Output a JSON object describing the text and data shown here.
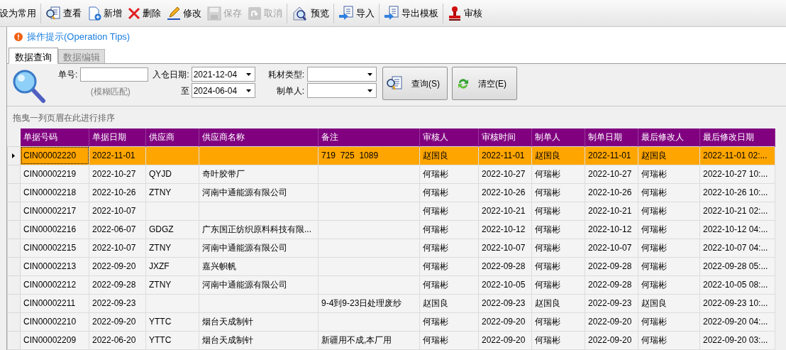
{
  "toolbar": [
    {
      "label": "设为常用",
      "kind": "text",
      "disabled": false
    },
    {
      "label": "查看",
      "kind": "view",
      "disabled": false
    },
    {
      "label": "新增",
      "kind": "add",
      "disabled": false
    },
    {
      "label": "删除",
      "kind": "delete",
      "disabled": false
    },
    {
      "label": "修改",
      "kind": "edit",
      "disabled": false
    },
    {
      "label": "保存",
      "kind": "save",
      "disabled": true
    },
    {
      "label": "取消",
      "kind": "cancel",
      "disabled": true
    },
    {
      "label": "预览",
      "kind": "preview",
      "disabled": false
    },
    {
      "label": "导入",
      "kind": "import",
      "disabled": false
    },
    {
      "label": "导出模板",
      "kind": "import",
      "disabled": false
    },
    {
      "label": "审核",
      "kind": "stamp",
      "disabled": false
    }
  ],
  "tip": "操作提示(Operation Tips)",
  "tabs": [
    {
      "label": "数据查询",
      "selected": true
    },
    {
      "label": "数据编辑",
      "selected": false
    }
  ],
  "filters": {
    "number_label": "单号:",
    "number_hint": "(模糊匹配)",
    "date_label": "入仓日期:",
    "date_from": "2021-12-04",
    "to_label": "至",
    "date_to": "2024-06-04",
    "type_label": "耗材类型:",
    "maker_label": "制单人:",
    "query_button": "查询(S)",
    "clear_button": "清空(E)"
  },
  "group_hint": "拖曳一列页眉在此进行排序",
  "table": {
    "columns": [
      "单据号码",
      "单据日期",
      "供应商",
      "供应商名称",
      "备注",
      "审核人",
      "审核时间",
      "制单人",
      "制单日期",
      "最后修改人",
      "最后修改日期"
    ],
    "rows": [
      {
        "selected": true,
        "cells": [
          "CIN00002220",
          "2022-11-01",
          "",
          "",
          "719  725  1089",
          "赵国良",
          "2022-11-01",
          "赵国良",
          "2022-11-01",
          "赵国良",
          "2022-11-01 02:..."
        ]
      },
      {
        "selected": false,
        "cells": [
          "CIN00002219",
          "2022-10-27",
          "QYJD",
          "奇叶胶带厂",
          "",
          "何瑞彬",
          "2022-10-27",
          "何瑞彬",
          "2022-10-27",
          "何瑞彬",
          "2022-10-27 10:..."
        ]
      },
      {
        "selected": false,
        "cells": [
          "CIN00002218",
          "2022-10-26",
          "ZTNY",
          "河南中通能源有限公司",
          "",
          "何瑞彬",
          "2022-10-26",
          "何瑞彬",
          "2022-10-26",
          "何瑞彬",
          "2022-10-26 10:..."
        ]
      },
      {
        "selected": false,
        "cells": [
          "CIN00002217",
          "2022-10-07",
          "",
          "",
          "",
          "何瑞彬",
          "2022-10-21",
          "何瑞彬",
          "2022-10-21",
          "何瑞彬",
          "2022-10-21 02:..."
        ]
      },
      {
        "selected": false,
        "cells": [
          "CIN00002216",
          "2022-06-07",
          "GDGZ",
          "广东国正纺织原料科技有限...",
          "",
          "何瑞彬",
          "2022-10-12",
          "何瑞彬",
          "2022-10-12",
          "何瑞彬",
          "2022-10-12 04:..."
        ]
      },
      {
        "selected": false,
        "cells": [
          "CIN00002215",
          "2022-10-07",
          "ZTNY",
          "河南中通能源有限公司",
          "",
          "何瑞彬",
          "2022-10-07",
          "何瑞彬",
          "2022-10-07",
          "何瑞彬",
          "2022-10-07 04:..."
        ]
      },
      {
        "selected": false,
        "cells": [
          "CIN00002213",
          "2022-09-20",
          "JXZF",
          "嘉兴帜帆",
          "",
          "何瑞彬",
          "2022-09-28",
          "何瑞彬",
          "2022-09-28",
          "何瑞彬",
          "2022-09-28 05:..."
        ]
      },
      {
        "selected": false,
        "cells": [
          "CIN00002212",
          "2022-09-28",
          "ZTNY",
          "河南中通能源有限公司",
          "",
          "何瑞彬",
          "2022-10-05",
          "何瑞彬",
          "2022-09-28",
          "何瑞彬",
          "2022-10-05 08:..."
        ]
      },
      {
        "selected": false,
        "cells": [
          "CIN00002211",
          "2022-09-23",
          "",
          "",
          "9-4到9-23日处理废纱",
          "赵国良",
          "2022-09-23",
          "赵国良",
          "2022-09-23",
          "赵国良",
          "2022-09-23 10:..."
        ]
      },
      {
        "selected": false,
        "cells": [
          "CIN00002210",
          "2022-09-20",
          "YTTC",
          "烟台天成制针",
          "",
          "何瑞彬",
          "2022-09-20",
          "何瑞彬",
          "2022-09-20",
          "何瑞彬",
          "2022-09-20 04:..."
        ]
      },
      {
        "selected": false,
        "cells": [
          "CIN00002209",
          "2022-06-20",
          "YTTC",
          "烟台天成制针",
          "新疆用不成,本厂用",
          "何瑞彬",
          "2022-09-20",
          "何瑞彬",
          "2022-09-20",
          "何瑞彬",
          "2022-09-20 03:..."
        ]
      }
    ]
  }
}
